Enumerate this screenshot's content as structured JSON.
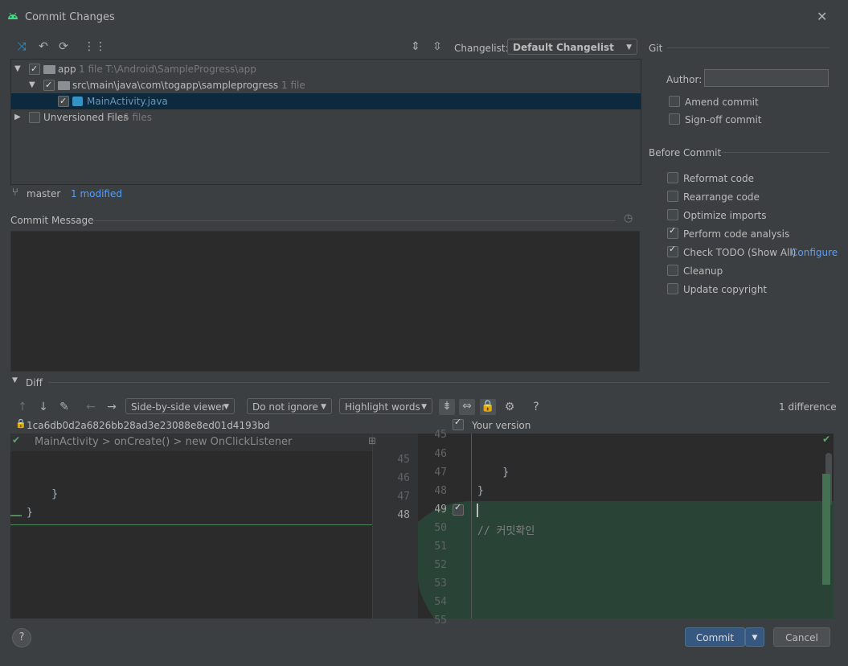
{
  "window": {
    "title": "Commit Changes"
  },
  "toolbar": {
    "changelist_label": "Changelist:",
    "changelist_value": "Default Changelist"
  },
  "tree": {
    "rows": [
      {
        "name": "app",
        "meta": "1 file  T:\\Android\\SampleProgress\\app"
      },
      {
        "name": "src\\main\\java\\com\\togapp\\sampleprogress",
        "meta": "1 file"
      },
      {
        "name": "MainActivity.java",
        "meta": ""
      },
      {
        "name": "Unversioned Files",
        "meta": "6 files"
      }
    ]
  },
  "status": {
    "branch": "master",
    "modified": "1 modified"
  },
  "commit_message": {
    "label": "Commit Message",
    "value": ""
  },
  "git": {
    "section": "Git",
    "author_label": "Author:",
    "author_value": "",
    "amend": "Amend commit",
    "signoff": "Sign-off commit"
  },
  "before_commit": {
    "section": "Before Commit",
    "options": [
      {
        "label": "Reformat code",
        "checked": false
      },
      {
        "label": "Rearrange code",
        "checked": false
      },
      {
        "label": "Optimize imports",
        "checked": false
      },
      {
        "label": "Perform code analysis",
        "checked": true
      },
      {
        "label": "Check TODO (Show All)",
        "checked": true
      },
      {
        "label": "Cleanup",
        "checked": false
      },
      {
        "label": "Update copyright",
        "checked": false
      }
    ],
    "configure": "Configure"
  },
  "diff": {
    "label": "Diff",
    "viewer": "Side-by-side viewer",
    "ignore": "Do not ignore",
    "highlight": "Highlight words",
    "difference_count": "1 difference",
    "left_revision": "1ca6db0d2a6826bb28ad3e23088e8ed01d4193bd",
    "right_revision": "Your version",
    "breadcrumb": [
      "MainActivity",
      ">",
      "onCreate()",
      ">",
      "new OnClickListener"
    ],
    "left_line_numbers": [
      "45",
      "46",
      "47",
      "48"
    ],
    "left_code": [
      "",
      "",
      "    }",
      "}"
    ],
    "right_line_numbers": [
      "45",
      "46",
      "47",
      "48",
      "49",
      "50",
      "51",
      "52",
      "53",
      "54",
      "55"
    ],
    "right_code": [
      "",
      "",
      "    }",
      "}",
      "",
      "// 커밋확인",
      "",
      "",
      "",
      "",
      ""
    ]
  },
  "buttons": {
    "help": "?",
    "commit": "Commit",
    "cancel": "Cancel"
  },
  "colors": {
    "accent": "#365880",
    "added_bg": "#294436",
    "selection": "#0d293e",
    "link": "#589df6"
  }
}
